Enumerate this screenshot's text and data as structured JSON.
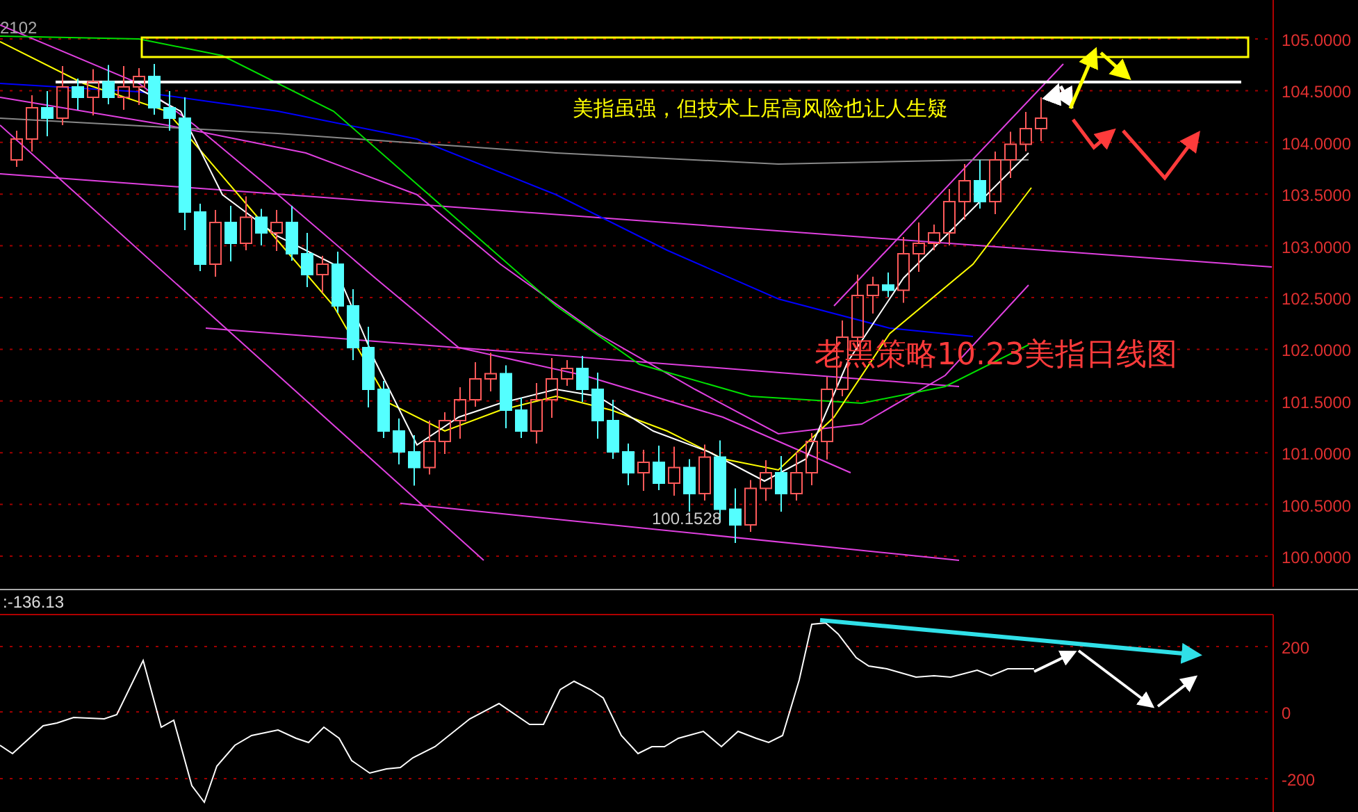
{
  "main_chart": {
    "corner_label": "2102",
    "annotation": "美指虽强，但技术上居高风险也让人生疑",
    "title": "老黑策略10.23美指日线图",
    "low_label": "100.1528",
    "price_axis": [
      "105.0000",
      "104.5000",
      "104.0000",
      "103.5000",
      "103.0000",
      "102.5000",
      "102.0000",
      "101.5000",
      "101.0000",
      "100.5000",
      "100.0000"
    ]
  },
  "indicator": {
    "value_label": ":-136.13",
    "axis": [
      "200",
      "0",
      "-200"
    ]
  }
}
